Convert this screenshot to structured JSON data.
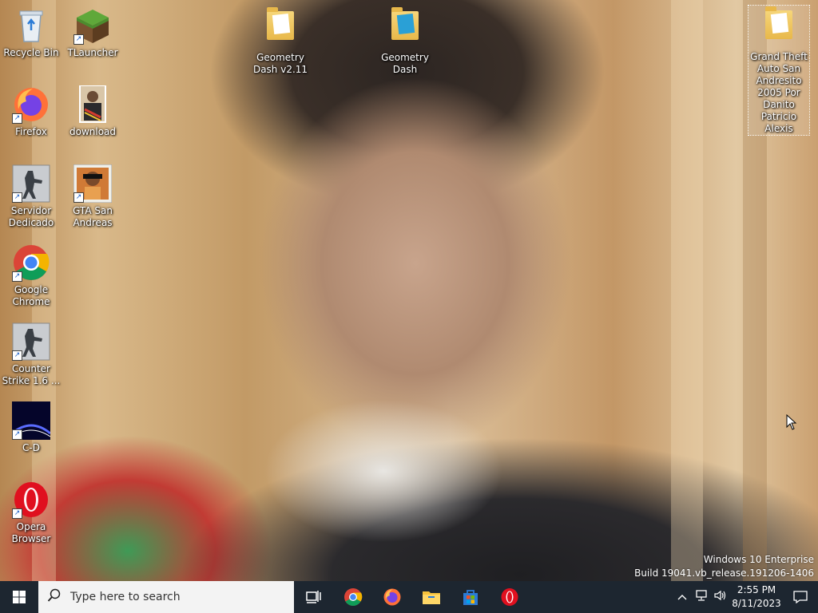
{
  "desktop": {
    "icons": [
      {
        "label": "Recycle Bin",
        "icon": "recycle-bin-icon"
      },
      {
        "label": "TLauncher",
        "icon": "tlauncher-icon"
      },
      {
        "label": "Geometry Dash v2.11",
        "icon": "folder-icon"
      },
      {
        "label": "Geometry Dash",
        "icon": "folder-icon"
      },
      {
        "label": "Grand Theft Auto San Andresito 2005 Por Danito Patricio Alexis",
        "icon": "folder-icon"
      },
      {
        "label": "Firefox",
        "icon": "firefox-icon"
      },
      {
        "label": "download",
        "icon": "image-file-icon"
      },
      {
        "label": "Servidor Dedicado",
        "icon": "counter-strike-icon"
      },
      {
        "label": "GTA San Andreas",
        "icon": "gta-san-andreas-icon"
      },
      {
        "label": "Google Chrome",
        "icon": "chrome-icon"
      },
      {
        "label": "Counter Strike 1.6 ...",
        "icon": "counter-strike-icon"
      },
      {
        "label": "C-D",
        "icon": "cd-app-icon"
      },
      {
        "label": "Opera Browser",
        "icon": "opera-icon"
      }
    ]
  },
  "watermark": {
    "line1": "Windows 10 Enterprise",
    "line2": "Build 19041.vb_release.191206-1406"
  },
  "taskbar": {
    "search_placeholder": "Type here to search",
    "pinned": [
      "task-view-icon",
      "chrome-icon",
      "firefox-icon",
      "file-explorer-icon",
      "microsoft-store-icon",
      "opera-icon"
    ],
    "clock": {
      "time": "2:55 PM",
      "date": "8/11/2023"
    }
  },
  "colors": {
    "taskbar_bg": "#1d2630",
    "search_bg": "#f3f3f3",
    "accent": "#0078d7"
  }
}
